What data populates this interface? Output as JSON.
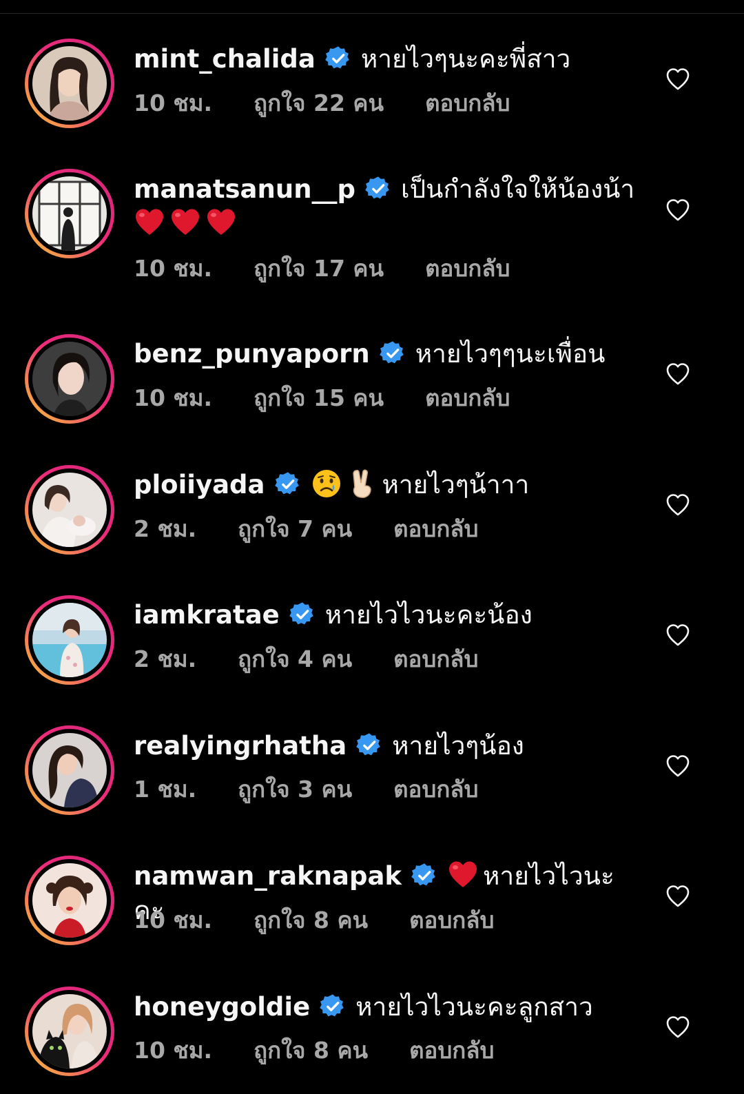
{
  "colors": {
    "background": "#000000",
    "text": "#f5f5f5",
    "meta": "#a8a8a8",
    "verified": "#3897f0",
    "ring_start": "#f9ce34",
    "ring_end": "#ee2a7b"
  },
  "comments": [
    {
      "username": "mint_chalida",
      "verified": true,
      "text": "หายไวๆนะคะพี่สาว",
      "emojis": [],
      "time": "10 ชม.",
      "likes": "ถูกใจ 22 คน",
      "reply": "ตอบกลับ",
      "like_icon": "heart-outline-icon"
    },
    {
      "username": "manatsanun__p",
      "verified": true,
      "text": "เป็นกำลังใจให้น้องน้า",
      "emojis_after": [
        "red-heart",
        "red-heart",
        "red-heart"
      ],
      "time": "10 ชม.",
      "likes": "ถูกใจ 17 คน",
      "reply": "ตอบกลับ",
      "like_icon": "heart-outline-icon"
    },
    {
      "username": "benz_punyaporn",
      "verified": true,
      "text": "หายไวๆๆนะเพื่อน",
      "emojis": [],
      "time": "10 ชม.",
      "likes": "ถูกใจ 15 คน",
      "reply": "ตอบกลับ",
      "like_icon": "heart-outline-icon"
    },
    {
      "username": "ploiiyada",
      "verified": true,
      "emojis": [
        "crying-face",
        "victory-hand"
      ],
      "text": "หายไวๆน้าาา",
      "time": "2 ชม.",
      "likes": "ถูกใจ 7 คน",
      "reply": "ตอบกลับ",
      "like_icon": "heart-outline-icon"
    },
    {
      "username": "iamkratae",
      "verified": true,
      "text": "หายไวไวนะคะน้อง",
      "emojis": [],
      "time": "2 ชม.",
      "likes": "ถูกใจ 4 คน",
      "reply": "ตอบกลับ",
      "like_icon": "heart-outline-icon"
    },
    {
      "username": "realyingrhatha",
      "verified": true,
      "text": "หายไวๆน้อง",
      "emojis": [],
      "time": "1 ชม.",
      "likes": "ถูกใจ 3 คน",
      "reply": "ตอบกลับ",
      "like_icon": "heart-outline-icon"
    },
    {
      "username": "namwan_raknapak",
      "verified": true,
      "emojis": [
        "red-heart"
      ],
      "text": "หายไวไวนะคะ",
      "time": "10 ชม.",
      "likes": "ถูกใจ 8 คน",
      "reply": "ตอบกลับ",
      "like_icon": "heart-outline-icon"
    },
    {
      "username": "honeygoldie",
      "verified": true,
      "text": "หายไวไวนะคะลูกสาว",
      "emojis": [],
      "time": "10 ชม.",
      "likes": "ถูกใจ 8 คน",
      "reply": "ตอบกลับ",
      "like_icon": "heart-outline-icon"
    }
  ]
}
